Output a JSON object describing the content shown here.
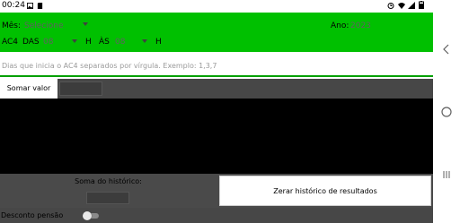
{
  "status_bar": {
    "time": "00:24",
    "icons": [
      "image-icon",
      "sd-card-icon",
      "alarm-icon",
      "wifi-icon",
      "signal-icon",
      "battery-icon"
    ]
  },
  "header": {
    "mes_label": "Mês:",
    "mes_value": "Selecione",
    "ano_label": "Ano:",
    "ano_value": "2023",
    "ac4_label": "AC4",
    "das_label": "DAS",
    "das_value": "08",
    "h_label": "H",
    "as_label": "ÀS",
    "as_value": "08"
  },
  "days_field": {
    "placeholder": "Dias que inicia o AC4 separados por vírgula. Exemplo: 1,3,7",
    "value": ""
  },
  "sum_row": {
    "button_label": "Somar valor",
    "value": ""
  },
  "history": {
    "label": "Soma do histórico:",
    "value": ""
  },
  "reset": {
    "button_label": "Zerar histórico de resultados"
  },
  "discount": {
    "label": "Desconto pensão",
    "enabled": false
  },
  "nav_bar": {
    "back_icon": "back-chevron-icon",
    "home_icon": "home-circle-icon",
    "recents_icon": "recents-icon"
  },
  "colors": {
    "header_green": "#00c000",
    "dark_panel": "#474747",
    "results_bg": "#000000"
  }
}
